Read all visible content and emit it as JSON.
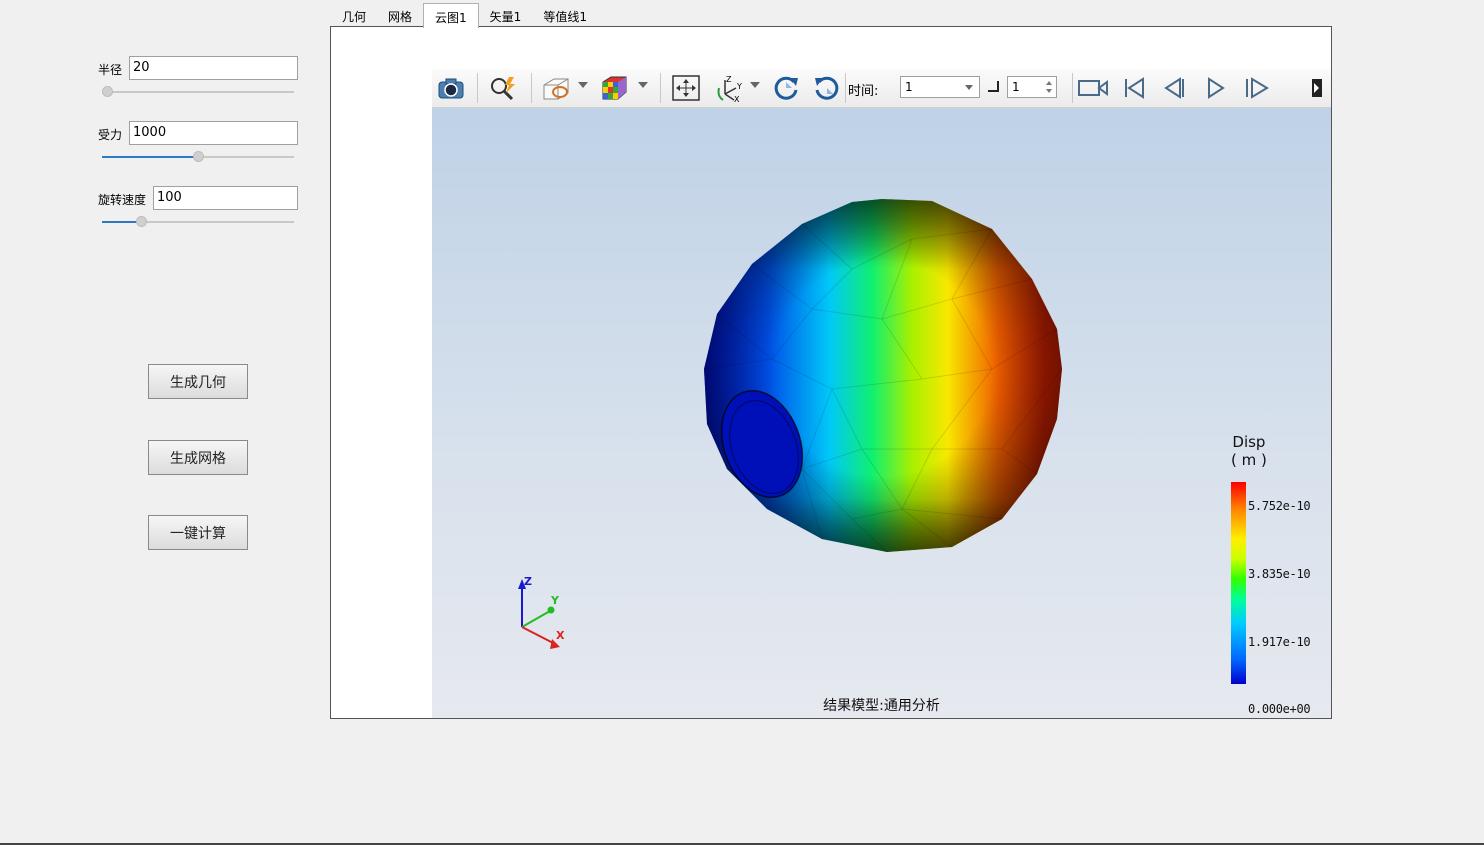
{
  "params": [
    {
      "label": "半径",
      "value": "20",
      "slider": 0.0
    },
    {
      "label": "受力",
      "value": "1000",
      "slider": 0.5
    },
    {
      "label": "旋转速度",
      "value": "100",
      "slider": 0.19
    }
  ],
  "buttons": {
    "geometry": "生成几何",
    "mesh": "生成网格",
    "compute": "一键计算"
  },
  "tabs": [
    {
      "label": "几何",
      "active": false
    },
    {
      "label": "网格",
      "active": false
    },
    {
      "label": "云图1",
      "active": true
    },
    {
      "label": "矢量1",
      "active": false
    },
    {
      "label": "等值线1",
      "active": false
    }
  ],
  "toolbar": {
    "time_label": "时间:",
    "time_value": "1",
    "step_value": "1",
    "icons": [
      "camera-icon",
      "probe-icon",
      "clip-icon",
      "colormap-cube-icon",
      "fit-view-icon",
      "axes-orient-icon",
      "rotate-cw-icon",
      "rotate-ccw-icon",
      "record-icon",
      "first-frame-icon",
      "prev-frame-icon",
      "play-icon",
      "next-frame-icon"
    ]
  },
  "legend": {
    "title_line1": "Disp",
    "title_line2": "( m )",
    "ticks": [
      "5.752e-10",
      "3.835e-10",
      "1.917e-10",
      "0.000e+00"
    ]
  },
  "axes": {
    "z": "Z",
    "y": "Y",
    "x": "X"
  },
  "footer": "结果模型:通用分析",
  "colors": {
    "accent": "#2f78c4",
    "background": "#f0f0f0"
  }
}
